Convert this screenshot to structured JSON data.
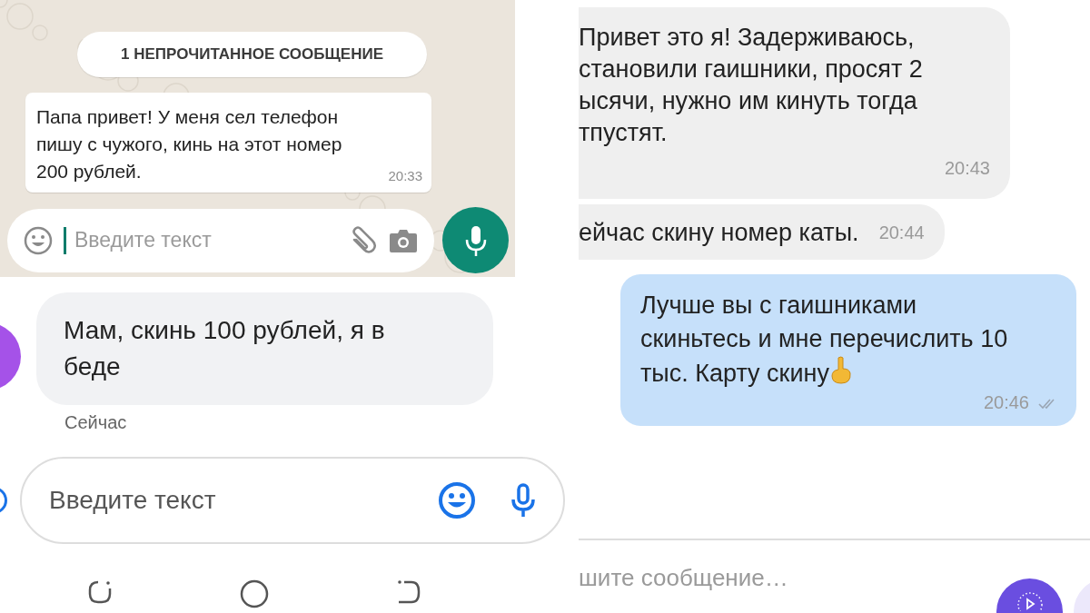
{
  "whatsapp": {
    "unread_banner": "1 НЕПРОЧИТАННОЕ СООБЩЕНИЕ",
    "message": {
      "lines": [
        "Папа привет! У меня сел телефон",
        "пишу с чужого, кинь на этот номер",
        "200 рублей."
      ],
      "time": "20:33"
    },
    "composer": {
      "placeholder": "Введите текст",
      "focused": true
    }
  },
  "sms": {
    "message": {
      "lines": [
        "Мам, скинь 100 рублей, я в",
        "беде"
      ],
      "time": "Сейчас"
    },
    "composer": {
      "placeholder": "Введите текст"
    }
  },
  "chat": {
    "messages": [
      {
        "kind": "incoming",
        "lines": [
          "Привет это я! Задерживаюсь,",
          "становили гаишники, просят 2",
          "ысячи, нужно им кинуть тогда",
          "тпустят."
        ],
        "time": "20:43"
      },
      {
        "kind": "incoming",
        "lines": [
          "ейчас скину номер каты."
        ],
        "time": "20:44"
      },
      {
        "kind": "outgoing",
        "lines": [
          "Лучше вы с гаишниками",
          "скиньтесь и мне перечислить 10",
          "тыс. Карту скину"
        ],
        "emoji": true,
        "time": "20:46",
        "read": true
      }
    ],
    "composer": {
      "placeholder": "шите сообщение…"
    }
  }
}
